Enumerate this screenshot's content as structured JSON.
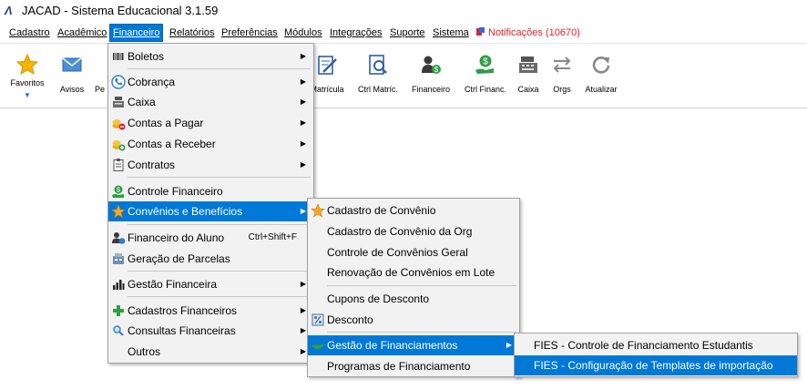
{
  "window": {
    "title": "JACAD - Sistema Educacional 3.1.59",
    "logo": "Λ"
  },
  "menubar": {
    "items": [
      {
        "label": "Cadastro",
        "active": false
      },
      {
        "label": "Acadêmico",
        "active": false
      },
      {
        "label": "Financeiro",
        "active": true
      },
      {
        "label": "Relatórios",
        "active": false
      },
      {
        "label": "Preferências",
        "active": false
      },
      {
        "label": "Módulos",
        "active": false
      },
      {
        "label": "Integrações",
        "active": false
      },
      {
        "label": "Suporte",
        "active": false
      },
      {
        "label": "Sistema",
        "active": false
      }
    ],
    "notifications": "Notificações (10670)"
  },
  "toolbar": {
    "items": [
      {
        "label": "Favoritos",
        "icon": "star-icon"
      },
      {
        "label": "Avisos",
        "icon": "envelope-icon"
      },
      {
        "label": "Pe",
        "icon": "person-icon"
      },
      {
        "label": "Matrícula",
        "icon": "form-pencil-icon"
      },
      {
        "label": "Ctrl Matríc.",
        "icon": "document-search-icon"
      },
      {
        "label": "Financeiro",
        "icon": "user-money-icon"
      },
      {
        "label": "Ctrl Financ.",
        "icon": "money-hand-icon"
      },
      {
        "label": "Caixa",
        "icon": "cash-register-icon"
      },
      {
        "label": "Orgs",
        "icon": "swap-arrows-icon"
      },
      {
        "label": "Atualizar",
        "icon": "refresh-icon"
      }
    ]
  },
  "financeiro_menu": {
    "items": [
      {
        "label": "Boletos",
        "icon": "barcode-icon",
        "submenu": true
      },
      {
        "label": "Cobrança",
        "icon": "phone-icon",
        "submenu": true
      },
      {
        "label": "Caixa",
        "icon": "cash-register-icon",
        "submenu": true
      },
      {
        "label": "Contas a Pagar",
        "icon": "coins-minus-icon",
        "submenu": true
      },
      {
        "label": "Contas a Receber",
        "icon": "coins-plus-icon",
        "submenu": true
      },
      {
        "label": "Contratos",
        "icon": "clipboard-icon",
        "submenu": true
      },
      {
        "label": "Controle Financeiro",
        "icon": "money-hand-icon",
        "submenu": false
      },
      {
        "label": "Convênios e Benefícios",
        "icon": "star-icon",
        "submenu": true,
        "highlighted": true
      },
      {
        "label": "Financeiro do Aluno",
        "icon": "user-money-icon",
        "submenu": false,
        "shortcut": "Ctrl+Shift+F"
      },
      {
        "label": "Geração de Parcelas",
        "icon": "generate-icon",
        "submenu": false
      },
      {
        "label": "Gestão Financeira",
        "icon": "bar-chart-icon",
        "submenu": true
      },
      {
        "label": "Cadastros Financeiros",
        "icon": "plus-icon",
        "submenu": true
      },
      {
        "label": "Consultas Financeiras",
        "icon": "magnifier-icon",
        "submenu": true
      },
      {
        "label": "Outros",
        "icon": "",
        "submenu": true
      }
    ]
  },
  "convenios_menu": {
    "items": [
      {
        "label": "Cadastro de Convênio",
        "icon": "star-icon"
      },
      {
        "label": "Cadastro de Convênio da Org",
        "icon": ""
      },
      {
        "label": "Controle de Convênios Geral",
        "icon": ""
      },
      {
        "label": "Renovação de Convênios em Lote",
        "icon": ""
      },
      {
        "label": "Cupons de Desconto",
        "icon": ""
      },
      {
        "label": "Desconto",
        "icon": "percent-icon"
      },
      {
        "label": "Gestão de Financiamentos",
        "icon": "handshake-icon",
        "submenu": true,
        "highlighted": true
      },
      {
        "label": "Programas de Financiamento",
        "icon": ""
      }
    ]
  },
  "financiamentos_menu": {
    "items": [
      {
        "label": "FIES - Controle de Financiamento Estudantis"
      },
      {
        "label": "FIES - Configuração de Templates de importação",
        "highlighted": true
      }
    ]
  },
  "colors": {
    "accent": "#0078d7",
    "notification": "#e0222a",
    "menu_bg": "#f2f2f2"
  }
}
